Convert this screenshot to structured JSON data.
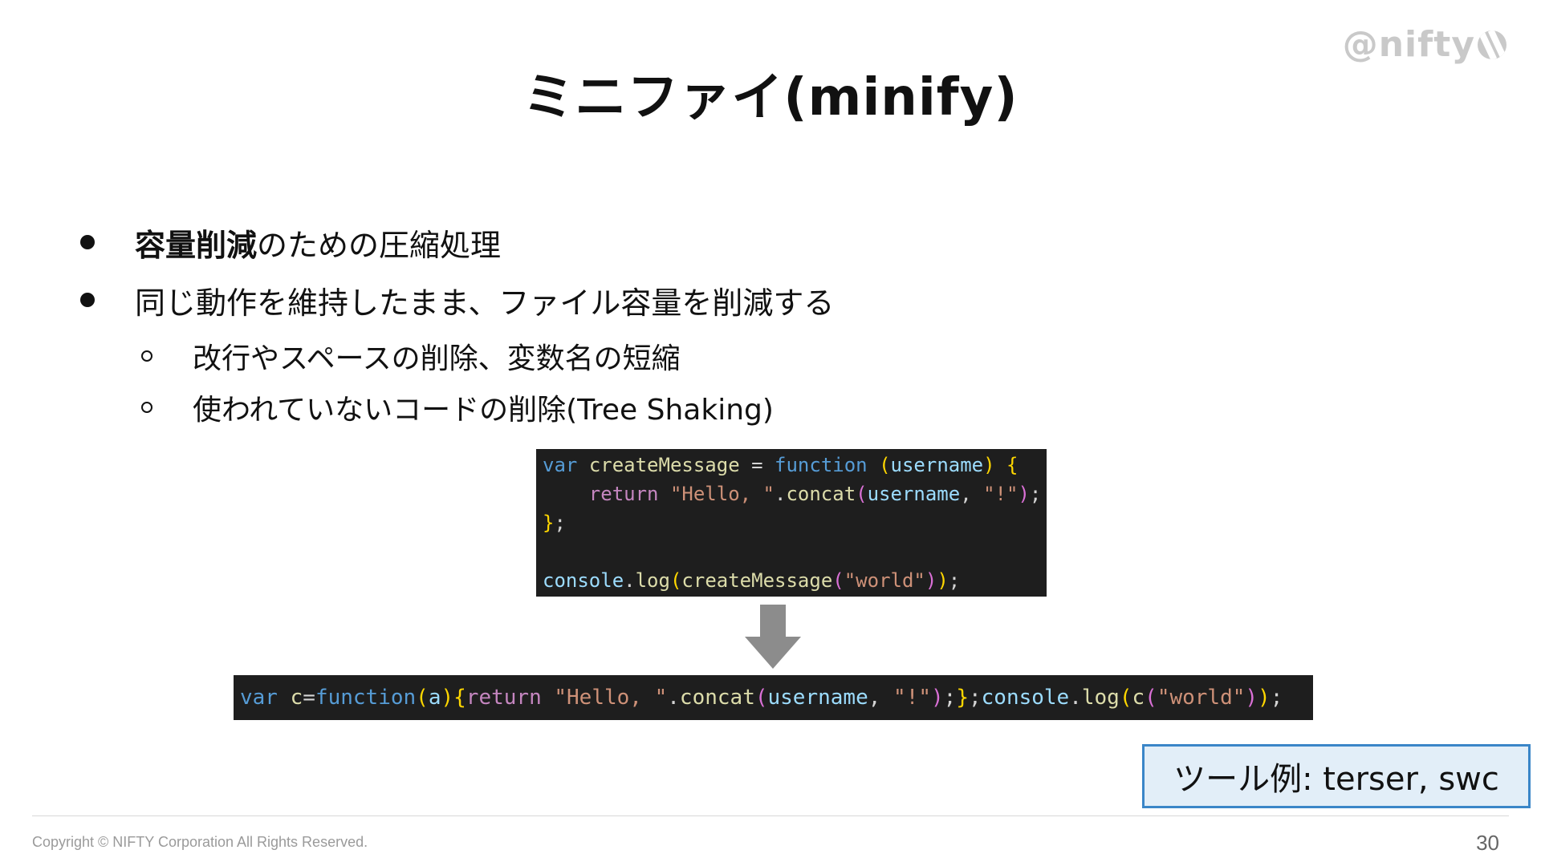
{
  "header": {
    "logo_text": "@nifty",
    "title": "ミニファイ(minify)"
  },
  "bullets": {
    "item1_bold": "容量削減",
    "item1_rest": "のための圧縮処理",
    "item2": "同じ動作を維持したまま、ファイル容量を削減する",
    "sub1": "改行やスペースの削除、変数名の短縮",
    "sub2": "使われていないコードの削除(Tree Shaking)"
  },
  "code_before": {
    "line1": [
      "var",
      "createMessage",
      "=",
      "function",
      "(",
      "username",
      ")",
      "{"
    ],
    "line2": [
      "return",
      "\"Hello, \"",
      ".",
      "concat",
      "(",
      "username",
      ",",
      "\"!\"",
      ")",
      ";"
    ],
    "line3": [
      "}",
      ";"
    ],
    "line4": [
      "console",
      ".",
      "log",
      "(",
      "createMessage",
      "(",
      "\"world\"",
      ")",
      ")",
      ";"
    ]
  },
  "code_after": {
    "tokens": [
      "var",
      "c",
      "=",
      "function",
      "(",
      "a",
      ")",
      "{",
      "return",
      "\"Hello, \"",
      ".",
      "concat",
      "(",
      "username",
      ",",
      "\"!\"",
      ")",
      ";",
      "}",
      ";",
      "console",
      ".",
      "log",
      "(",
      "c",
      "(",
      "\"world\"",
      ")",
      ")",
      ";"
    ]
  },
  "arrow_icon": "down-arrow-icon",
  "tool_box": {
    "text": "ツール例: terser, swc"
  },
  "footer": {
    "copyright": "Copyright © NIFTY Corporation All Rights Reserved.",
    "page_number": "30"
  },
  "colors": {
    "code_bg": "#1e1e1e",
    "tool_box_border": "#3a86c8",
    "tool_box_bg": "#e2eef8",
    "logo": "#c9c9c9"
  }
}
